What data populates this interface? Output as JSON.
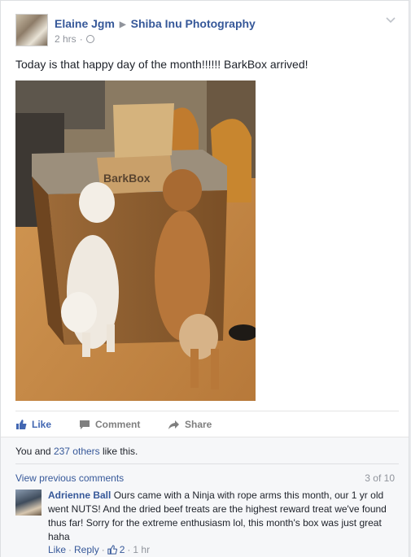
{
  "post": {
    "author": "Elaine Jgm",
    "page": "Shiba Inu Photography",
    "time": "2 hrs",
    "dot": "·",
    "text": "Today is that happy day of the month!!!!!! BarkBox arrived!",
    "photo_box_text": "BarkBox"
  },
  "actions": {
    "like": "Like",
    "comment": "Comment",
    "share": "Share"
  },
  "likes": {
    "prefix": "You and ",
    "others": "237 others",
    "suffix": " like this."
  },
  "comments": {
    "view_previous": "View previous comments",
    "count": "3 of 10",
    "items": [
      {
        "author": "Adrienne Ball",
        "text": " Ours came with a Ninja with rope arms this month, our 1 yr old went NUTS! And the dried beef treats are the highest reward treat we've found thus far! Sorry for the extreme enthusiasm lol, this month's box was just great haha",
        "like": "Like",
        "reply": "Reply",
        "dot1": "·",
        "dot2": "·",
        "dot3": "·",
        "likes": "2",
        "time": "1 hr"
      }
    ]
  },
  "colors": {
    "link": "#365899",
    "like_active": "#4267b2",
    "muted": "#90949c"
  }
}
